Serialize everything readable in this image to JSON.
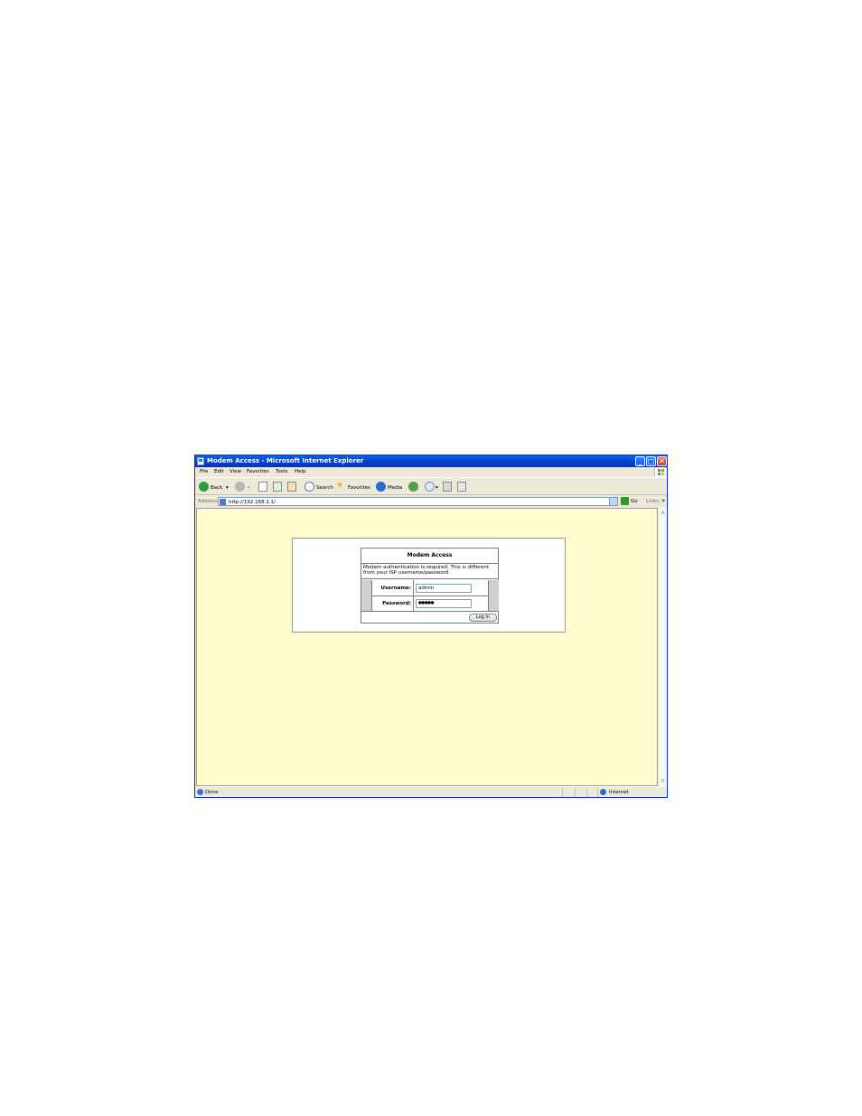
{
  "window": {
    "title": "Modem Access - Microsoft Internet Explorer",
    "min_glyph": "_",
    "max_glyph": "□",
    "close_glyph": "✕"
  },
  "menu": [
    "File",
    "Edit",
    "View",
    "Favorites",
    "Tools",
    "Help"
  ],
  "toolbar": {
    "back": "Back",
    "search": "Search",
    "favorites": "Favorites",
    "media": "Media"
  },
  "address": {
    "label": "Address",
    "url": "http://192.168.1.1/",
    "go": "Go",
    "links": "Links",
    "more": "»"
  },
  "login": {
    "heading": "Modem Access",
    "description": "Modem authentication is required. This is different from your ISP username/password.",
    "username_label": "Username:",
    "username_value": "admin",
    "password_label": "Password:",
    "password_value": "●●●●●",
    "button": "Log In"
  },
  "status": {
    "text": "Done",
    "zone": "Internet"
  },
  "colors": {
    "page_background": "#fffccd",
    "titlebar": "#0a5ff0"
  }
}
